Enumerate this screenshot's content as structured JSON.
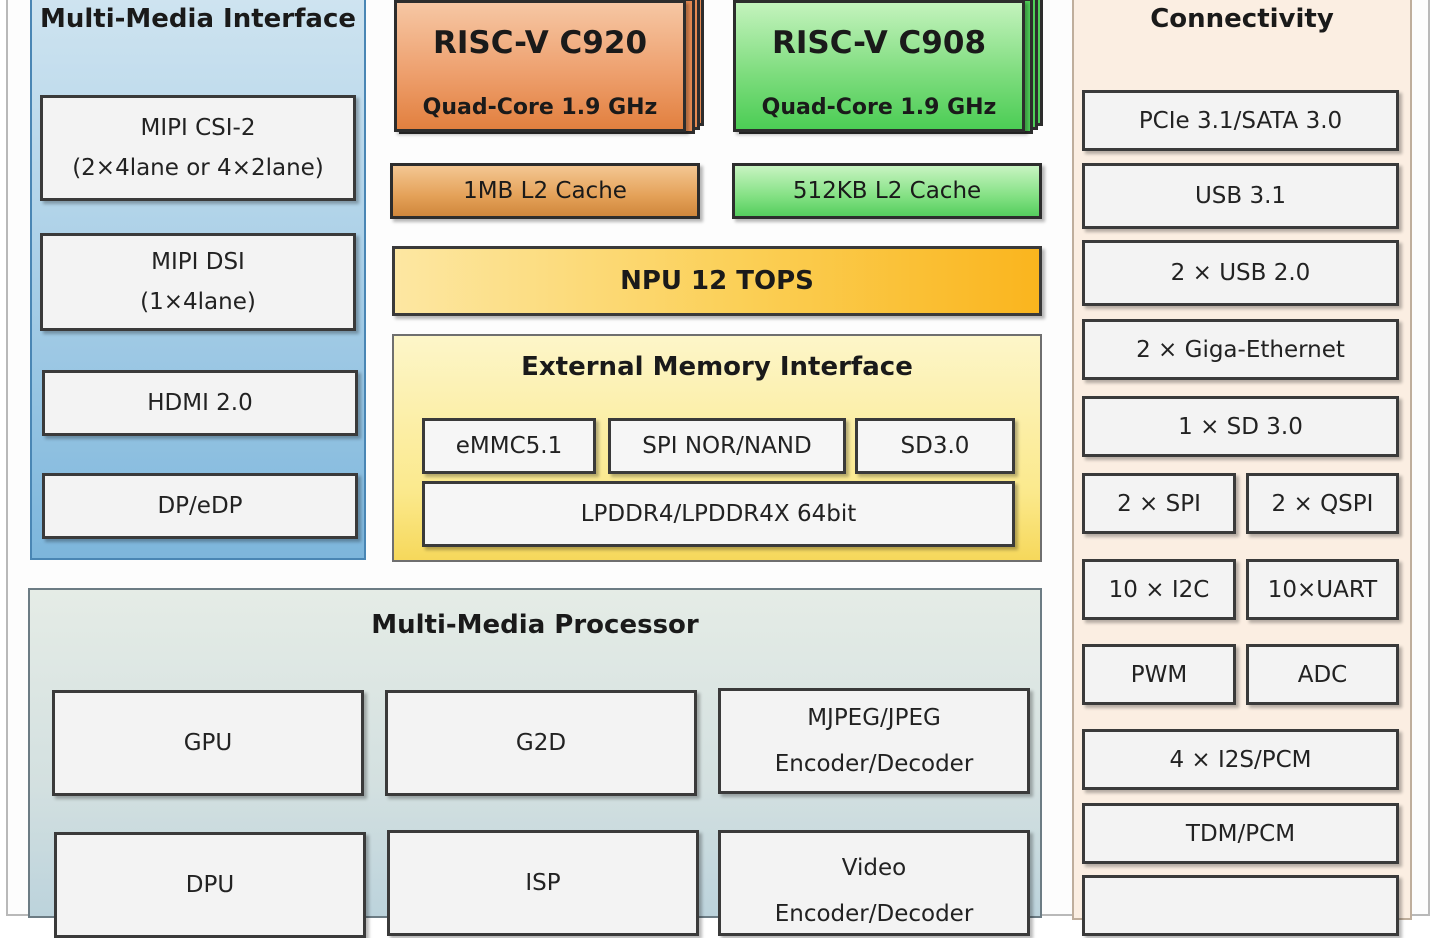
{
  "multimedia_interface": {
    "title": "Multi-Media Interface",
    "items": [
      {
        "line1": "MIPI CSI-2",
        "line2": "(2×4lane or 4×2lane)"
      },
      {
        "line1": "MIPI DSI",
        "line2": "(1×4lane)"
      },
      {
        "line1": "HDMI 2.0"
      },
      {
        "line1": "DP/eDP"
      }
    ]
  },
  "cpu": {
    "c920": {
      "name": "RISC-V C920",
      "sub": "Quad-Core 1.9 GHz",
      "cache": "1MB L2 Cache"
    },
    "c908": {
      "name": "RISC-V C908",
      "sub": "Quad-Core 1.9 GHz",
      "cache": "512KB L2 Cache"
    }
  },
  "npu": {
    "label": "NPU 12 TOPS"
  },
  "memory": {
    "title": "External Memory Interface",
    "emmc": "eMMC5.1",
    "spi": "SPI NOR/NAND",
    "sd": "SD3.0",
    "lpddr": "LPDDR4/LPDDR4X 64bit"
  },
  "connectivity": {
    "title": "Connectivity",
    "pcie": "PCIe 3.1/SATA 3.0",
    "usb31": "USB 3.1",
    "usb20": "2 × USB 2.0",
    "eth": "2 × Giga-Ethernet",
    "sd": "1 × SD 3.0",
    "spi": "2 × SPI",
    "qspi": "2 × QSPI",
    "i2c": "10 × I2C",
    "uart": "10×UART",
    "pwm": "PWM",
    "adc": "ADC",
    "i2s": "4 × I2S/PCM",
    "tdm": "TDM/PCM"
  },
  "processor": {
    "title": "Multi-Media Processor",
    "gpu": "GPU",
    "g2d": "G2D",
    "mjpeg_line1": "MJPEG/JPEG",
    "mjpeg_line2": "Encoder/Decoder",
    "dpu": "DPU",
    "isp": "ISP",
    "video_line1": "Video",
    "video_line2": "Encoder/Decoder"
  },
  "colors": {
    "c920_top": "#f4b98e",
    "c920_bottom": "#e6874a",
    "c908_top": "#b9f0b2",
    "c908_bottom": "#4fcf58",
    "npu": "#fbcf55",
    "interface_panel": "#a9cfe7",
    "connectivity_panel": "#fbeee2",
    "memory_panel": "#fbe98c"
  }
}
